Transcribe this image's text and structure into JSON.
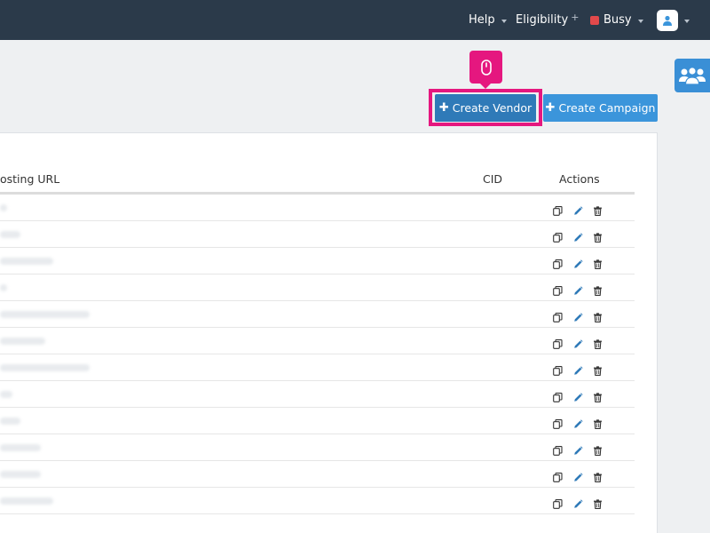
{
  "nav": {
    "help": "Help",
    "eligibility": "Eligibility",
    "eligibility_suffix": "+",
    "status": "Busy"
  },
  "toolbar": {
    "create_vendor": "Create Vendor",
    "create_campaign": "Create Campaign",
    "plus": "✚"
  },
  "table": {
    "columns": [
      "osting URL",
      "CID",
      "Actions"
    ],
    "rows": [
      {
        "url": "t",
        "cid": ""
      },
      {
        "url": "tests",
        "cid": ""
      },
      {
        "url": "testdellalese",
        "cid": ""
      },
      {
        "url": "t",
        "cid": ""
      },
      {
        "url": "testdellalesecabetto 1",
        "cid": ""
      },
      {
        "url": "testdellall",
        "cid": ""
      },
      {
        "url": "testdellalesecabetto 2",
        "cid": ""
      },
      {
        "url": "tes",
        "cid": ""
      },
      {
        "url": "testa",
        "cid": ""
      },
      {
        "url": "testdellal",
        "cid": ""
      },
      {
        "url": "testdellal",
        "cid": ""
      },
      {
        "url": "testdellalese",
        "cid": ""
      }
    ]
  },
  "colors": {
    "topbar": "#2b3a4a",
    "primary": "#3b95db",
    "vendor_button": "#2f7ab8",
    "highlight": "#e5177f",
    "busy": "#e2494b"
  },
  "icons": {
    "copy": "copy-icon",
    "edit": "pencil-icon",
    "delete": "trash-icon",
    "mouse": "mouse-icon",
    "team": "users-icon",
    "user": "user-icon"
  }
}
